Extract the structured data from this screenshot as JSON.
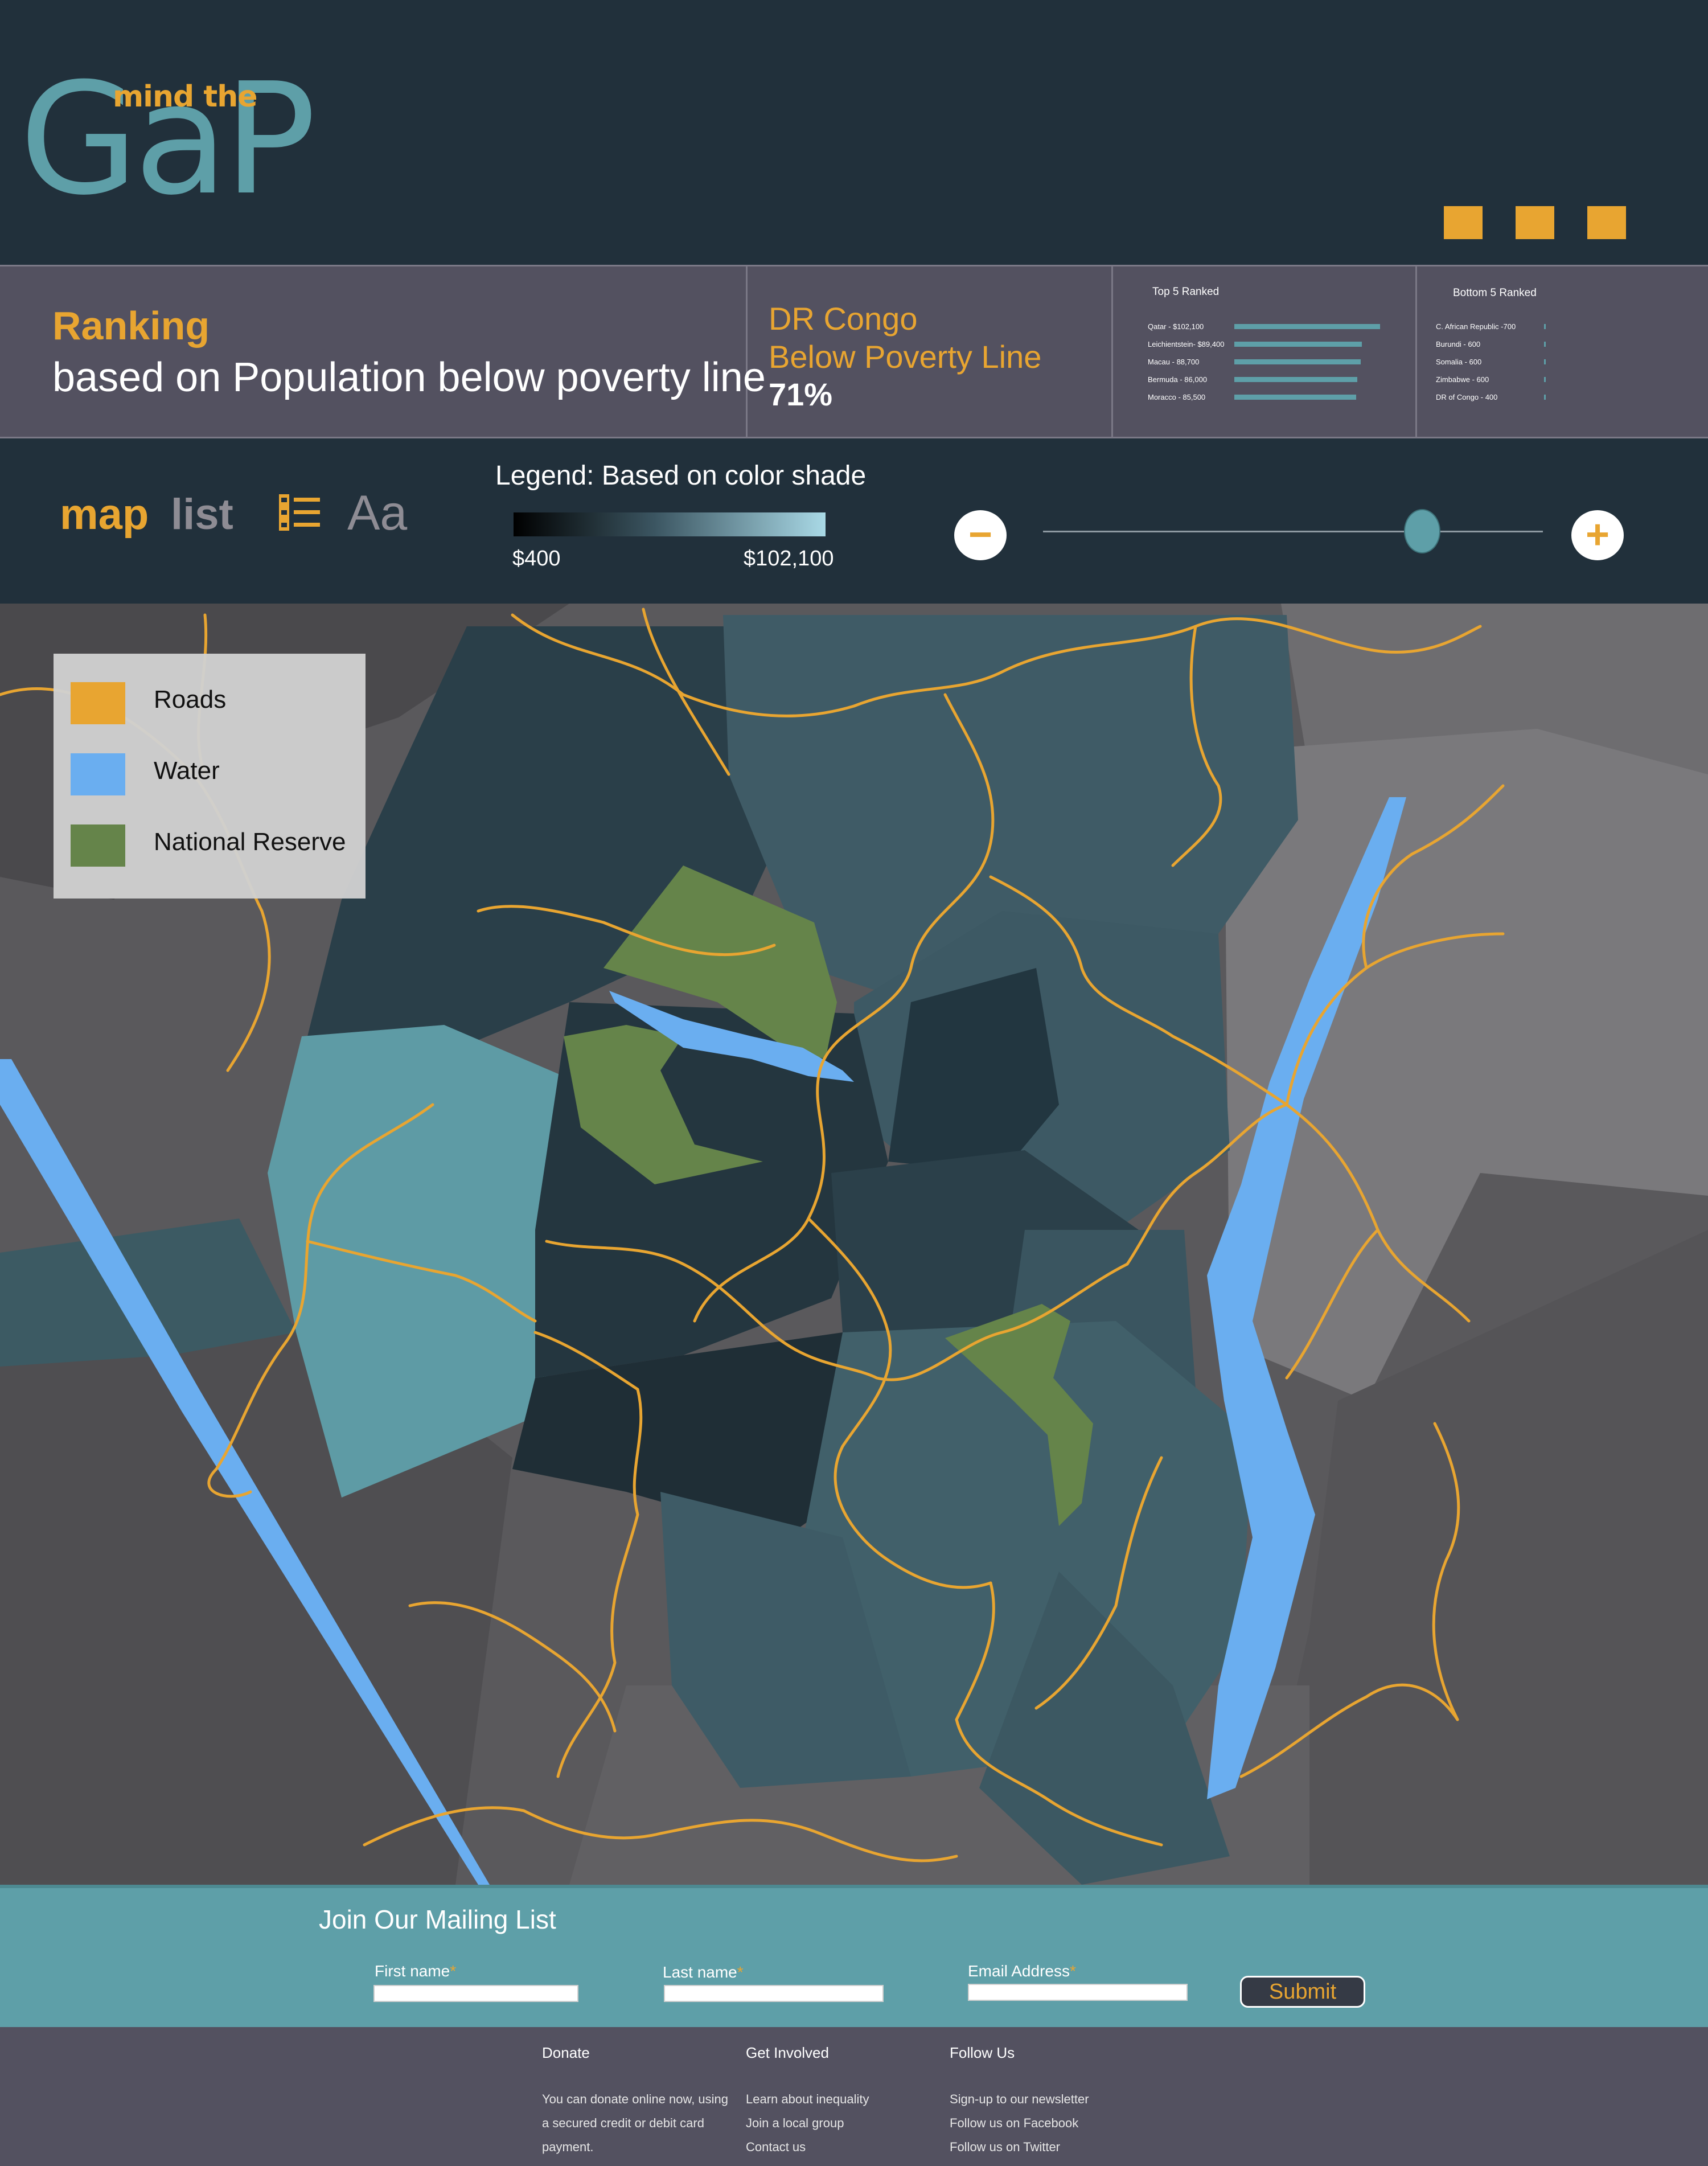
{
  "logo": {
    "small": "mind the",
    "big": "GaP"
  },
  "ranking": {
    "title": "Ranking",
    "subtitle": "based on Population below poverty line",
    "country": "DR Congo",
    "indicator": "Below Poverty Line",
    "value": "71%",
    "top5": {
      "heading": "Top 5 Ranked",
      "items": [
        {
          "label": "Qatar - $102,100",
          "value": 102100
        },
        {
          "label": "Leichientstein- $89,400",
          "value": 89400
        },
        {
          "label": "Macau - 88,700",
          "value": 88700
        },
        {
          "label": "Bermuda - 86,000",
          "value": 86000
        },
        {
          "label": "Moracco - 85,500",
          "value": 85500
        }
      ]
    },
    "bottom5": {
      "heading": "Bottom 5 Ranked",
      "items": [
        {
          "label": "C. African Republic -700",
          "value": 700
        },
        {
          "label": "Burundi - 600",
          "value": 600
        },
        {
          "label": "Somalia - 600",
          "value": 600
        },
        {
          "label": "Zimbabwe - 600",
          "value": 600
        },
        {
          "label": "DR of Congo - 400",
          "value": 400
        }
      ]
    }
  },
  "controls": {
    "tab_map": "map",
    "tab_list": "list",
    "font_toggle": "Aa",
    "legend_title": "Legend: Based on color shade",
    "legend_min": "$400",
    "legend_max": "$102,100",
    "zoom_out": "−",
    "zoom_in": "+",
    "zoom_level_fraction": 0.75
  },
  "map_legend": {
    "items": [
      {
        "label": "Roads",
        "color": "#e8a531"
      },
      {
        "label": "Water",
        "color": "#6aaef0"
      },
      {
        "label": "National Reserve",
        "color": "#65844a"
      }
    ]
  },
  "mailing": {
    "title": "Join Our Mailing List",
    "first_name": "First name",
    "last_name": "Last name",
    "email": "Email Address",
    "required_mark": "*",
    "submit": "Submit"
  },
  "footer": {
    "columns": [
      {
        "heading": "Donate",
        "lines": [
          "You can donate online now, using",
          "a secured credit or debit card",
          "payment."
        ]
      },
      {
        "heading": "Get Involved",
        "lines": [
          "Learn about inequality",
          "Join a local group",
          "Contact us"
        ]
      },
      {
        "heading": "Follow Us",
        "lines": [
          "Sign-up to our newsletter",
          "Follow us on Facebook",
          "Follow us on Twitter"
        ]
      }
    ]
  },
  "colors": {
    "accent": "#e8a531",
    "teal": "#5e9fa8",
    "dark_bg": "#21303b",
    "panel_bg": "#535160"
  }
}
